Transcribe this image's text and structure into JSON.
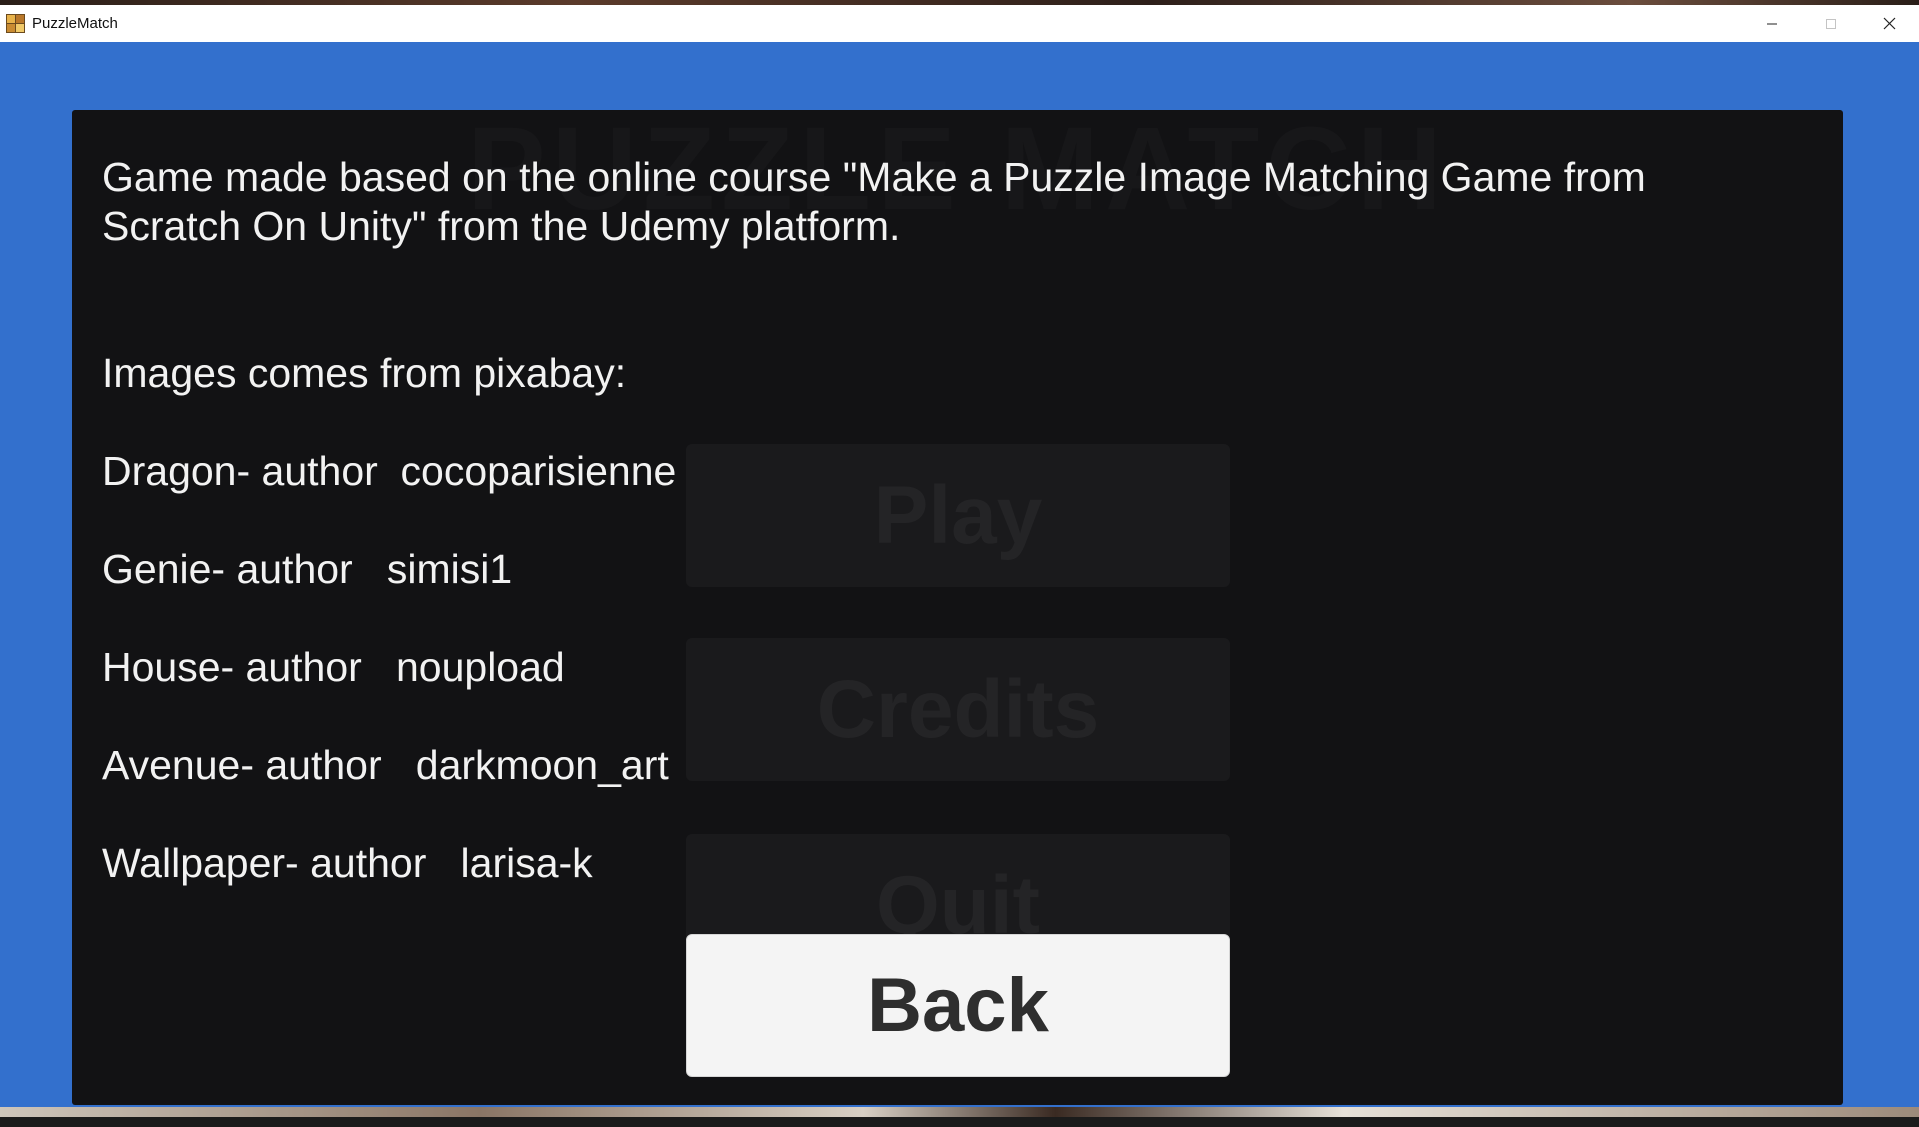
{
  "window": {
    "title": "PuzzleMatch",
    "app_icon": "puzzle-app-icon",
    "controls": {
      "minimize_icon": "minimize-icon",
      "maximize_icon": "maximize-icon",
      "close_icon": "close-icon"
    }
  },
  "background_menu": {
    "title": "PUZZLE MATCH",
    "play_label": "Play",
    "credits_label": "Credits",
    "quit_label": "Quit"
  },
  "credits": {
    "intro": "Game made based on the online course \"Make a Puzzle Image Matching Game from Scratch On Unity\" from the Udemy platform.",
    "images_heading": "Images comes from pixabay:",
    "entries": [
      "Dragon- author  cocoparisienne",
      "Genie- author   simisi1",
      "House- author   noupload",
      "Avenue- author   darkmoon_art",
      "Wallpaper- author   larisa-k"
    ]
  },
  "back_button": {
    "label": "Back"
  },
  "colors": {
    "game_background": "#3370cd",
    "panel": "#121214",
    "text": "#f2f2f2",
    "button": "#f4f4f4",
    "button_text": "#2e2e2e"
  }
}
